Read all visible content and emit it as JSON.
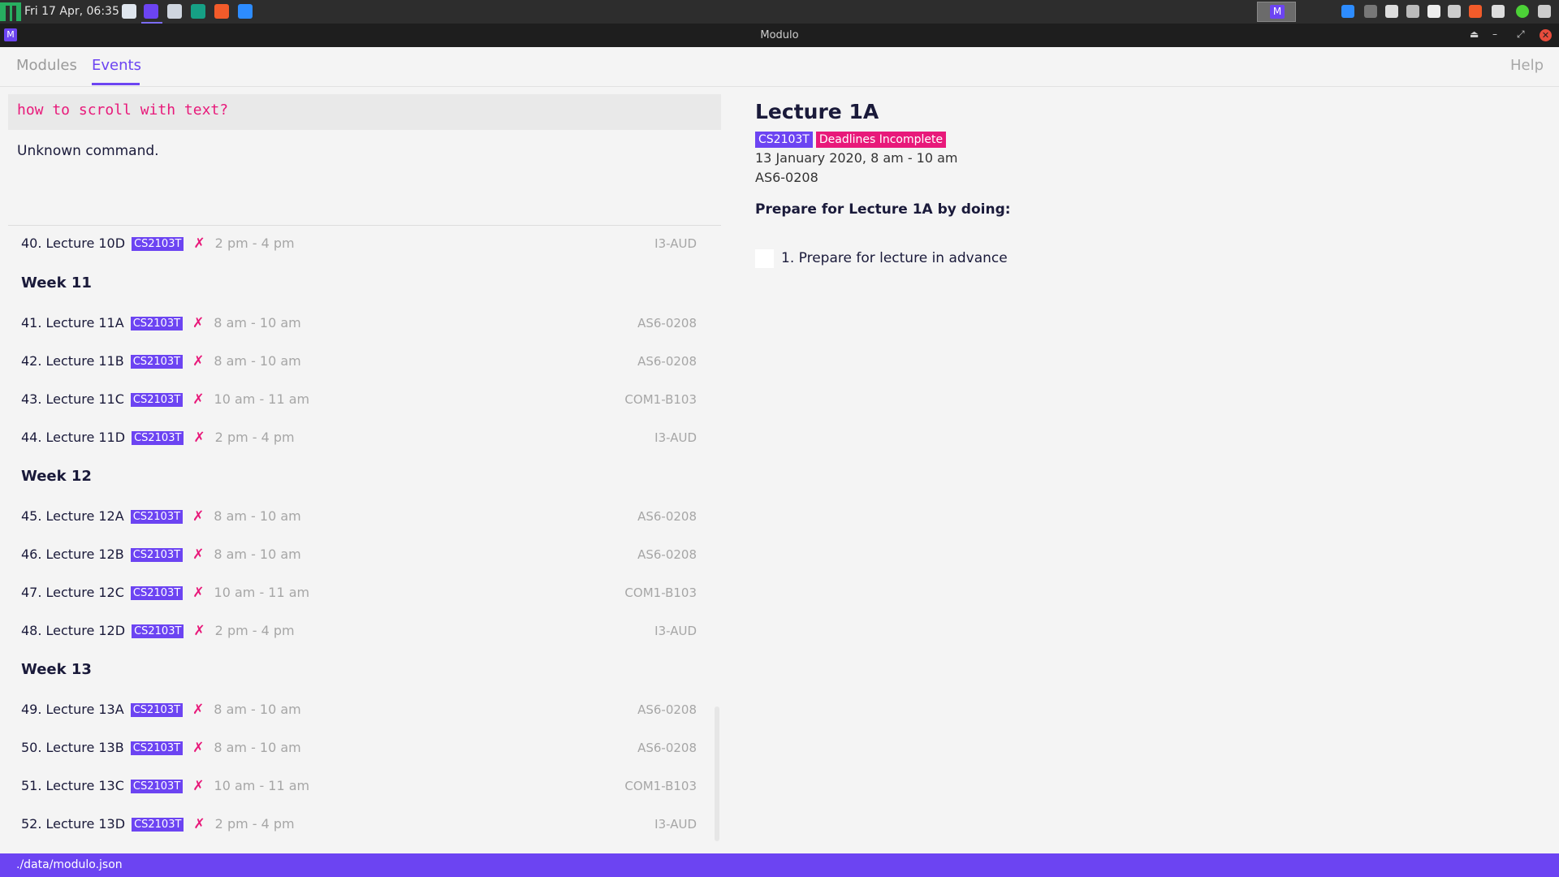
{
  "taskbar": {
    "clock": "Fri 17 Apr, 06:35",
    "active_window_glyph": "M"
  },
  "window": {
    "title": "Modulo",
    "icon_glyph": "M"
  },
  "tabs": [
    {
      "label": "Modules"
    },
    {
      "label": "Events"
    }
  ],
  "help_label": "Help",
  "command": {
    "value": "how to scroll with text?"
  },
  "result_message": "Unknown command.",
  "events": [
    {
      "title": "40. Lecture 10D",
      "module": "CS2103T",
      "done_mark": "✗",
      "time": "2 pm - 4 pm",
      "location": "I3-AUD"
    },
    {
      "week": "Week 11"
    },
    {
      "title": "41. Lecture 11A",
      "module": "CS2103T",
      "done_mark": "✗",
      "time": "8 am - 10 am",
      "location": "AS6-0208"
    },
    {
      "title": "42. Lecture 11B",
      "module": "CS2103T",
      "done_mark": "✗",
      "time": "8 am - 10 am",
      "location": "AS6-0208"
    },
    {
      "title": "43. Lecture 11C",
      "module": "CS2103T",
      "done_mark": "✗",
      "time": "10 am - 11 am",
      "location": "COM1-B103"
    },
    {
      "title": "44. Lecture 11D",
      "module": "CS2103T",
      "done_mark": "✗",
      "time": "2 pm - 4 pm",
      "location": "I3-AUD"
    },
    {
      "week": "Week 12"
    },
    {
      "title": "45. Lecture 12A",
      "module": "CS2103T",
      "done_mark": "✗",
      "time": "8 am - 10 am",
      "location": "AS6-0208"
    },
    {
      "title": "46. Lecture 12B",
      "module": "CS2103T",
      "done_mark": "✗",
      "time": "8 am - 10 am",
      "location": "AS6-0208"
    },
    {
      "title": "47. Lecture 12C",
      "module": "CS2103T",
      "done_mark": "✗",
      "time": "10 am - 11 am",
      "location": "COM1-B103"
    },
    {
      "title": "48. Lecture 12D",
      "module": "CS2103T",
      "done_mark": "✗",
      "time": "2 pm - 4 pm",
      "location": "I3-AUD"
    },
    {
      "week": "Week 13"
    },
    {
      "title": "49. Lecture 13A",
      "module": "CS2103T",
      "done_mark": "✗",
      "time": "8 am - 10 am",
      "location": "AS6-0208"
    },
    {
      "title": "50. Lecture 13B",
      "module": "CS2103T",
      "done_mark": "✗",
      "time": "8 am - 10 am",
      "location": "AS6-0208"
    },
    {
      "title": "51. Lecture 13C",
      "module": "CS2103T",
      "done_mark": "✗",
      "time": "10 am - 11 am",
      "location": "COM1-B103"
    },
    {
      "title": "52. Lecture 13D",
      "module": "CS2103T",
      "done_mark": "✗",
      "time": "2 pm - 4 pm",
      "location": "I3-AUD"
    }
  ],
  "detail": {
    "title": "Lecture 1A",
    "module": "CS2103T",
    "status": "Deadlines Incomplete",
    "date": "13 January 2020, 8 am - 10 am",
    "location": "AS6-0208",
    "prep_heading": "Prepare for Lecture 1A by doing:",
    "tasks": [
      {
        "label": "1. Prepare for lecture in advance",
        "done": false
      }
    ]
  },
  "status_bar": {
    "path": "./data/modulo.json"
  },
  "colors": {
    "accent": "#6c44f2",
    "pink": "#e8197a"
  },
  "icons": [
    "menu-icon",
    "files-icon",
    "modulo-icon",
    "document-icon",
    "folder-icon",
    "brave-icon",
    "zoom-icon",
    "bluetooth-icon",
    "battery-icon",
    "wifi-icon",
    "shield-icon",
    "link-icon",
    "volume-icon",
    "update-icon",
    "notes-icon",
    "close-icon"
  ]
}
